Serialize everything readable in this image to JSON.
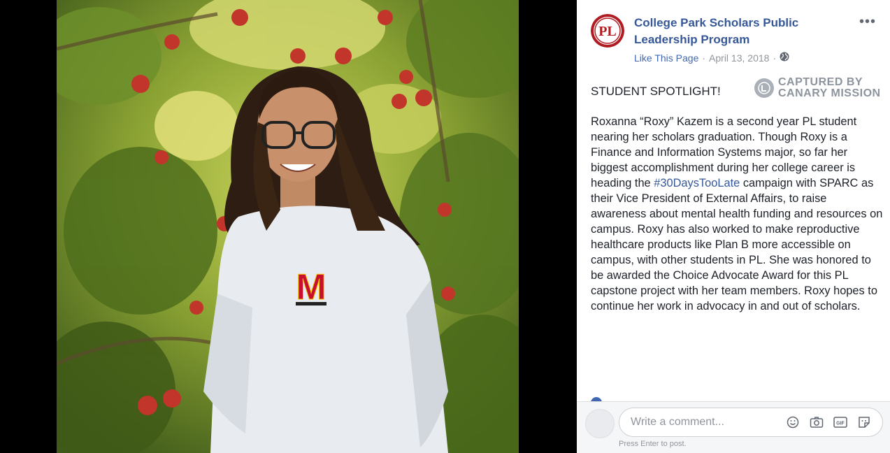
{
  "post": {
    "page_name": "College Park Scholars Public Leadership Program",
    "avatar_text": "PL",
    "like_label": "Like This Page",
    "separator": "·",
    "date": "April 13, 2018",
    "more_label": "•••",
    "spotlight": "STUDENT SPOTLIGHT!",
    "watermark_line1": "CAPTURED BY",
    "watermark_line2": "CANARY MISSION",
    "body_part1": "Roxanna “Roxy” Kazem is a second year PL student nearing her scholars graduation. Though Roxy is a Finance and Information Systems major, so far her biggest accomplishment during her college career is heading the ",
    "hashtag": "#30DaysTooLate",
    "body_part2": " campaign with SPARC as their Vice President of External Affairs, to raise awareness about mental health funding and resources on campus. Roxy has also worked to make reproductive healthcare products like Plan B more accessible on campus, with other students in PL. She was honored to be awarded the Choice Advocate Award for this PL capstone project with her team members. Roxy hopes to continue her work in advocacy in and out of scholars."
  },
  "comment": {
    "placeholder": "Write a comment...",
    "press_enter": "Press Enter to post.",
    "icons": [
      "emoji-icon",
      "camera-icon",
      "gif-icon",
      "sticker-icon"
    ],
    "gif_label": "GIF"
  },
  "photo": {
    "shirt_letter": "M"
  },
  "colors": {
    "link": "#365899",
    "accent": "#4267b2",
    "shirt_red": "#c8102e"
  }
}
